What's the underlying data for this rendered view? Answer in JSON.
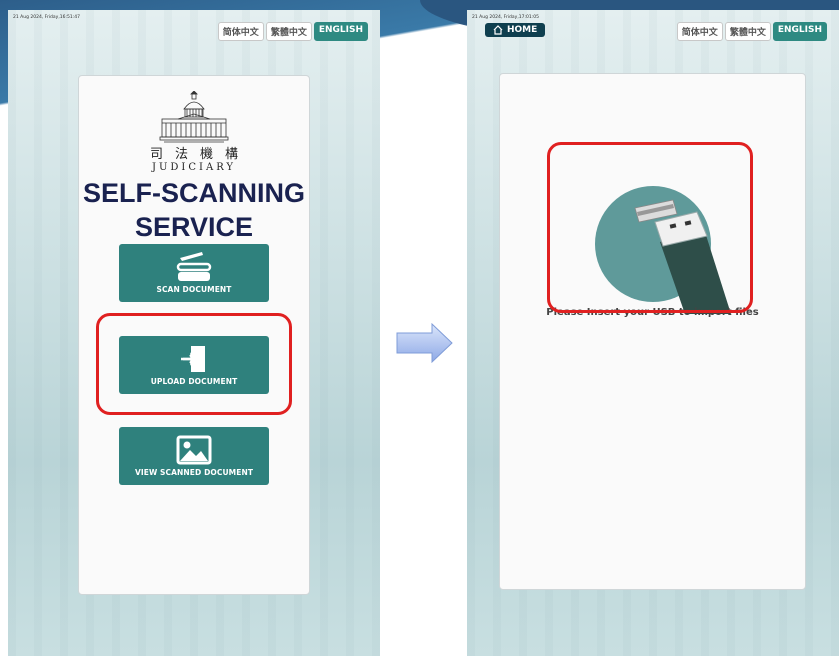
{
  "left_screen": {
    "timestamp": "21 Aug 2024, Friday,16:51:47",
    "languages": [
      {
        "label": "简体中文",
        "active": false
      },
      {
        "label": "繁體中文",
        "active": false
      },
      {
        "label": "ENGLISH",
        "active": true
      }
    ],
    "logo": {
      "chinese": "司法機構",
      "english": "JUDICIARY"
    },
    "title_line1": "SELF-SCANNING",
    "title_line2": "SERVICE",
    "buttons": {
      "scan": "SCAN DOCUMENT",
      "upload": "UPLOAD DOCUMENT",
      "view": "VIEW SCANNED DOCUMENT"
    }
  },
  "right_screen": {
    "timestamp": "21 Aug 2024, Friday,17:01:05",
    "home_label": "HOME",
    "languages": [
      {
        "label": "简体中文",
        "active": false
      },
      {
        "label": "繁體中文",
        "active": false
      },
      {
        "label": "ENGLISH",
        "active": true
      }
    ],
    "usb_message": "Please Insert your USB to import files"
  },
  "colors": {
    "button_teal": "#2f817d",
    "title_navy": "#1a2250",
    "highlight_red": "#e02020",
    "home_dark": "#0f3f4f"
  },
  "icons": {
    "scan": "scanner-icon",
    "upload": "upload-arrow-icon",
    "view": "image-icon",
    "home": "home-icon",
    "usb": "usb-drive-icon",
    "transition": "right-arrow-icon"
  }
}
